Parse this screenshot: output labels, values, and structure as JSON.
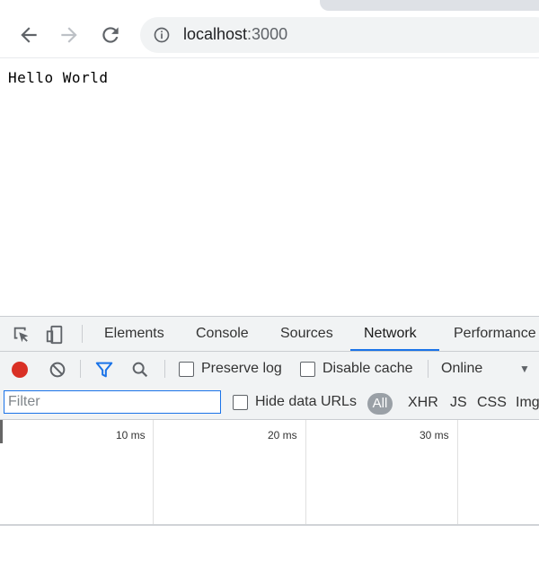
{
  "browser": {
    "url_host": "localhost",
    "url_port": ":3000",
    "icons": [
      "back-arrow-icon",
      "forward-arrow-icon",
      "reload-icon",
      "info-icon"
    ]
  },
  "page": {
    "text": "Hello World"
  },
  "devtools": {
    "tabs": [
      "Elements",
      "Console",
      "Sources",
      "Network",
      "Performance"
    ],
    "active_tab": "Network",
    "accent_color": "#1a73e8",
    "record_color": "#d93025",
    "toolbar": {
      "preserve_log": "Preserve log",
      "disable_cache": "Disable cache",
      "throttling": "Online"
    },
    "filter": {
      "placeholder": "Filter",
      "hide_data_urls": "Hide data URLs",
      "types": [
        "All",
        "XHR",
        "JS",
        "CSS",
        "Img"
      ]
    },
    "timeline": {
      "labels": [
        "10 ms",
        "20 ms",
        "30 ms"
      ]
    }
  }
}
